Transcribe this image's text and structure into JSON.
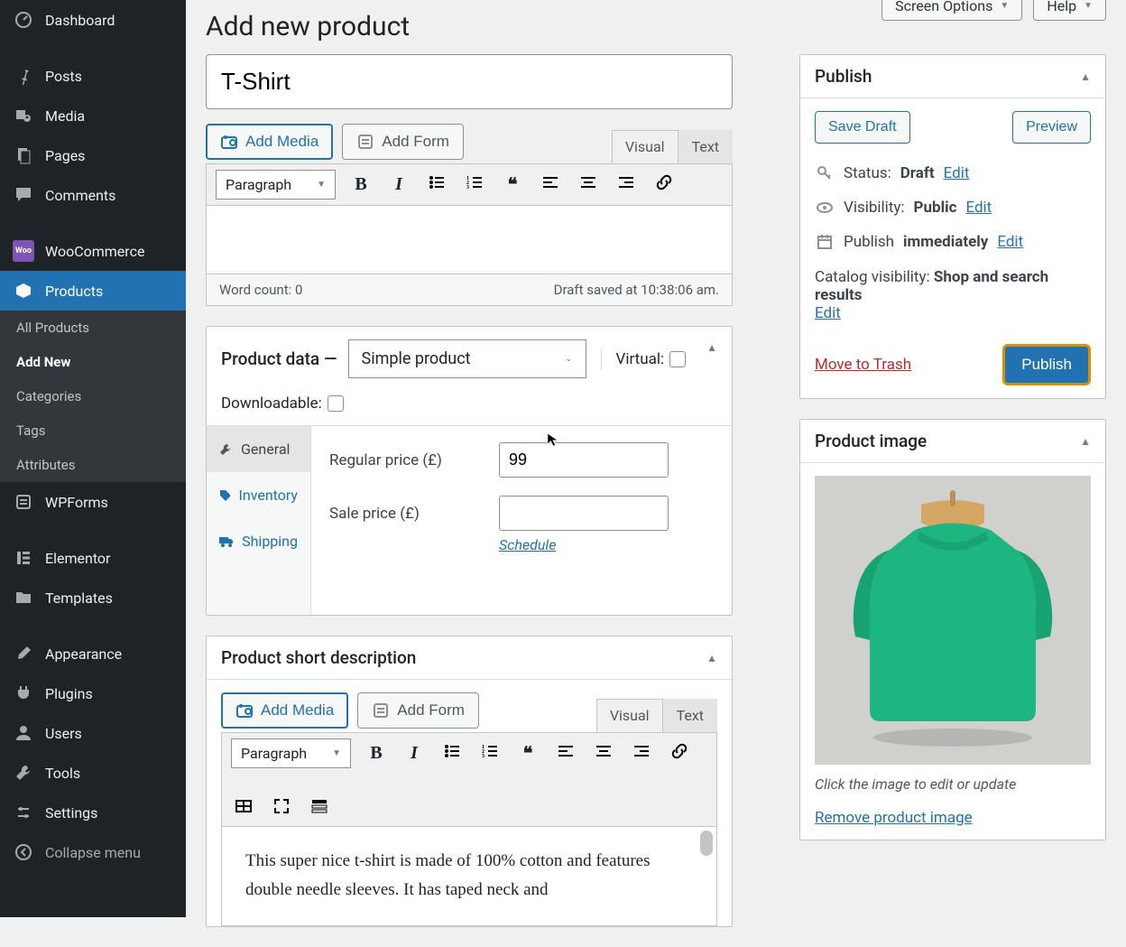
{
  "topbar": {
    "screen_options": "Screen Options",
    "help": "Help"
  },
  "sidebar": {
    "dashboard": "Dashboard",
    "posts": "Posts",
    "media": "Media",
    "pages": "Pages",
    "comments": "Comments",
    "woocommerce": "WooCommerce",
    "products": "Products",
    "wpforms": "WPForms",
    "elementor": "Elementor",
    "templates": "Templates",
    "appearance": "Appearance",
    "plugins": "Plugins",
    "users": "Users",
    "tools": "Tools",
    "settings": "Settings",
    "collapse": "Collapse menu",
    "sub": {
      "all": "All Products",
      "add": "Add New",
      "cat": "Categories",
      "tags": "Tags",
      "attr": "Attributes"
    }
  },
  "page_title": "Add new product",
  "product_title": "T-Shirt",
  "editor": {
    "add_media": "Add Media",
    "add_form": "Add Form",
    "visual": "Visual",
    "text": "Text",
    "paragraph": "Paragraph",
    "wordcount": "Word count: 0",
    "draft_saved": "Draft saved at 10:38:06 am."
  },
  "product_data": {
    "heading": "Product data —",
    "type": "Simple product",
    "virtual": "Virtual:",
    "downloadable": "Downloadable:",
    "tabs": {
      "general": "General",
      "inventory": "Inventory",
      "shipping": "Shipping"
    },
    "regular_price_label": "Regular price (£)",
    "regular_price_value": "99",
    "sale_price_label": "Sale price (£)",
    "sale_price_value": "",
    "schedule": "Schedule"
  },
  "short_desc": {
    "heading": "Product short description",
    "content": "This super nice t-shirt is made of 100% cotton and features double needle sleeves. It has taped neck and"
  },
  "publish": {
    "heading": "Publish",
    "save_draft": "Save Draft",
    "preview": "Preview",
    "status_label": "Status:",
    "status_value": "Draft",
    "visibility_label": "Visibility:",
    "visibility_value": "Public",
    "publish_label": "Publish",
    "publish_value": "immediately",
    "catalog_label": "Catalog visibility:",
    "catalog_value": "Shop and search results",
    "edit": "Edit",
    "trash": "Move to Trash",
    "publish_btn": "Publish"
  },
  "product_image": {
    "heading": "Product image",
    "caption": "Click the image to edit or update",
    "remove": "Remove product image",
    "color": "#1db680"
  }
}
